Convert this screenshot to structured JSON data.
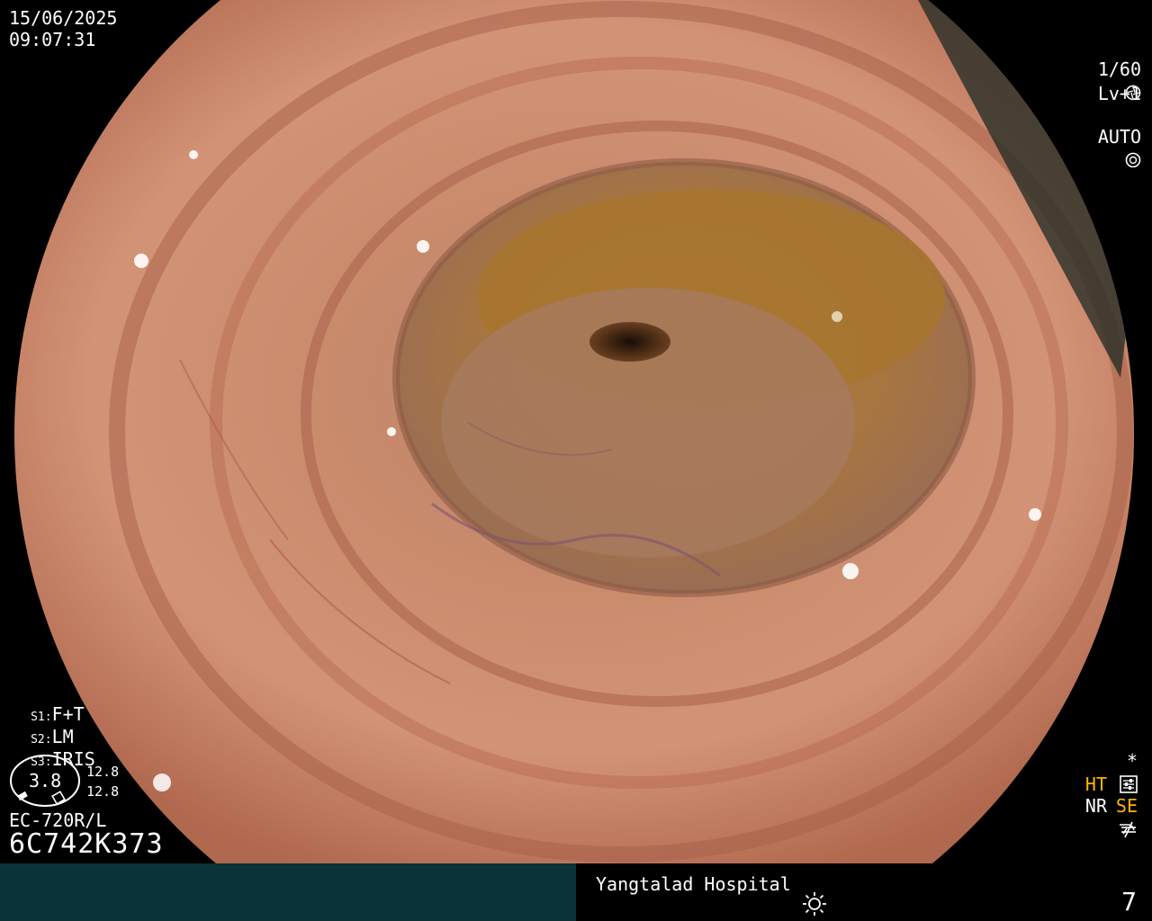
{
  "overlay": {
    "date": "15/06/2025",
    "time": "09:07:31",
    "shutter": "1/60",
    "level": "Lv+1",
    "iris_mode": "AUTO",
    "switches": [
      {
        "key": "S1",
        "value": "F+T"
      },
      {
        "key": "S2",
        "value": "LM"
      },
      {
        "key": "S3",
        "value": "IRIS"
      }
    ],
    "gauge_value": "3.8",
    "gauge_readings": [
      "12.8",
      "12.8"
    ],
    "scope_model": "EC-720R/L",
    "serial": "6C742K373",
    "status": {
      "star": "*",
      "ht": "HT",
      "nr": "NR",
      "se": "SE",
      "highlight_color": "#ffb400"
    }
  },
  "footer": {
    "hospital": "Yangtalad Hospital",
    "page_number": "7"
  }
}
